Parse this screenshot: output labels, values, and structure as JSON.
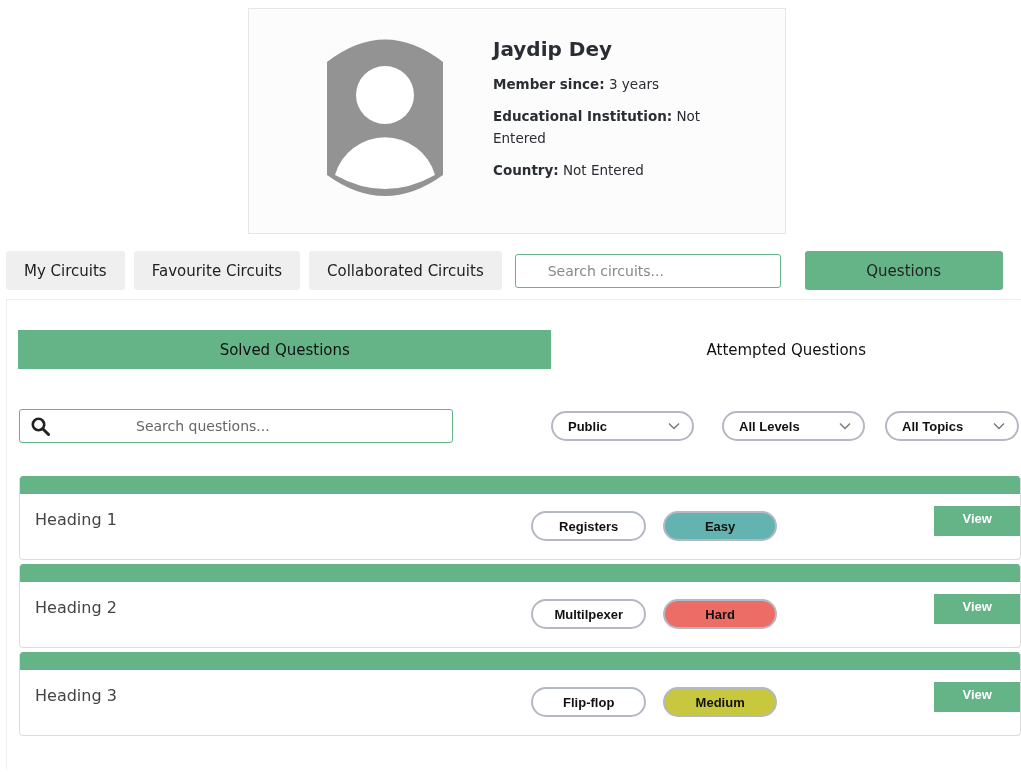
{
  "profile": {
    "name": "Jaydip Dey",
    "fields": [
      {
        "label": "Member since:",
        "value": "3 years"
      },
      {
        "label": "Educational Institution:",
        "value": "Not Entered"
      },
      {
        "label": "Country:",
        "value": "Not Entered"
      }
    ]
  },
  "nav": {
    "buttons": [
      {
        "label": "My Circuits",
        "selected": false
      },
      {
        "label": "Favourite Circuits",
        "selected": false
      },
      {
        "label": "Collaborated Circuits",
        "selected": false
      }
    ],
    "search": {
      "placeholder": "Search circuits..."
    },
    "questions_button": {
      "label": "Questions",
      "selected": true
    }
  },
  "tabs": [
    {
      "label": "Solved Questions",
      "selected": true
    },
    {
      "label": "Attempted Questions",
      "selected": false
    }
  ],
  "search": {
    "placeholder": "Search questions..."
  },
  "filters": [
    {
      "label": "Public"
    },
    {
      "label": "All Levels"
    },
    {
      "label": "All Topics"
    }
  ],
  "questions": [
    {
      "heading": "Heading 1",
      "topic": "Registers",
      "difficulty": "Easy",
      "color": "#63b3b1",
      "action": "View"
    },
    {
      "heading": "Heading 2",
      "topic": "Multilpexer",
      "difficulty": "Hard",
      "color": "#ec6d66",
      "action": "View"
    },
    {
      "heading": "Heading 3",
      "topic": "Flip-flop",
      "difficulty": "Medium",
      "color": "#c8c83e",
      "action": "View"
    }
  ]
}
